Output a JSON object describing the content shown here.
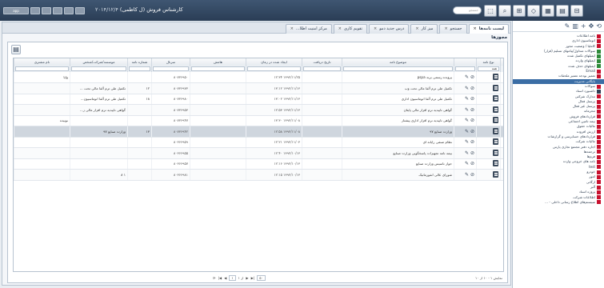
{
  "topbar": {
    "title": "کارشناس فروش (ل کاظمی)",
    "date": "۲۰۱۴/۱۲/۴",
    "search_placeholder": "جستجو",
    "window_buttons": [
      "",
      "",
      "",
      "",
      ""
    ],
    "right_buttons": [
      "⬚",
      "🔍",
      "⊞",
      "◇",
      "▦",
      "⊟"
    ]
  },
  "tabs": [
    {
      "label": "لیست نامه‌ها",
      "active": true
    },
    {
      "label": "جستجو",
      "active": false
    },
    {
      "label": "میز کار",
      "active": false
    },
    {
      "label": "درس جدید دمو",
      "active": false
    },
    {
      "label": "تقویم کاری",
      "active": false
    },
    {
      "label": "مرکز امنیت اطلا...",
      "active": false
    }
  ],
  "panel_title": "مجوزها",
  "columns": [
    "",
    "نوع نامه",
    "",
    "موضوع نامه",
    "تاریخ دریافت",
    "ایجاد شده در زمان",
    "هامش",
    "سرنال",
    "شماره نامه",
    "موسسه/شرکت/شخص",
    "نام مشتری"
  ],
  "filters": [
    "",
    "همه",
    "",
    "",
    "",
    "",
    "",
    "",
    "",
    "",
    ""
  ],
  "rows": [
    {
      "num": "۱",
      "subject": "پرونده رسمی برند pspa",
      "date": "۱۳۹۲/۱۱/۲۵ ۱۲:۳۴",
      "serial": "۸۰۷۳۶۹۵۰",
      "letter_no": "",
      "org": "",
      "customer": "وایا"
    },
    {
      "num": "۲",
      "subject": "تکمیل طی ترم آلفا مالی تحت وب",
      "date": "۱۳۹۲/۱۱/۱۳ ۱۳:۱۲",
      "serial": "۸۰۷۳۶۹۷۳",
      "letter_no": "۱۲",
      "org": "تکمیل طی ترم آلفا مالی تحت ...",
      "customer": ""
    },
    {
      "num": "۳",
      "subject": "تکمیل طی ترم آلفا اتوماسیون اداری",
      "date": "۱۳۹۲/۱۱/۱۳ ۱۳:۰۲",
      "serial": "۸۰۷۳۶۹۸۰",
      "letter_no": "۱۸",
      "org": "تکمیل طی ترم آلفا اتوماسیون...",
      "customer": ""
    },
    {
      "num": "۴",
      "subject": "گواهی تاییدیه نرم افزار مالی پایتان",
      "date": "۱۳۹۲/۱۱/۱۳ ۱۲:۵۳",
      "serial": "۸۰۷۳۶۹۵۳",
      "letter_no": "",
      "org": "گواهی تاییدیه نرم افزار مالی ز...",
      "customer": ""
    },
    {
      "num": "۵",
      "subject": "گواهی تاییدیه نرم افزار اداری پیشتاز",
      "date": "۱۳۹۲/۱۱/۰۸ ۱۳:۳۰",
      "serial": "۸۰۷۳۶۹۴۷",
      "letter_no": "",
      "org": "",
      "customer": "نونیده"
    },
    {
      "num": "۶",
      "subject": "وزارت صنایع ۹۷",
      "date": "۱۳۹۲/۱۱/۰۸ ۱۲:۵۸",
      "serial": "۸۰۷۳۶۹۴۲",
      "letter_no": "۱۳",
      "org": "وزارت صنایع ۹۷",
      "customer": ""
    },
    {
      "num": "۷",
      "subject": "نظام صنفی رایانه ای",
      "date": "۱۳۹۲/۱۱/۰۳ ۱۲:۲۱",
      "serial": "۸۰۳۶۶۹۵۹",
      "letter_no": "",
      "org": "",
      "customer": ""
    },
    {
      "num": "۸",
      "subject": "بیمه نامه تجهیزات پاسخگویی وزارت صنایع",
      "date": "۱۳۹۲/۱۰/۱۳ ۱۲:۴۰",
      "serial": "۸۰۳۶۶۹۵۵",
      "letter_no": "",
      "org": "",
      "customer": ""
    },
    {
      "num": "۹",
      "subject": "جواز تاسیس وزارت صنایع",
      "date": "۱۳۹۲/۱۰/۱۳ ۱۲:۱۶",
      "serial": "۸۰۳۶۶۹۵۷",
      "letter_no": "",
      "org": "",
      "customer": ""
    },
    {
      "num": "۱۰",
      "subject": "شوراى عالی انفورماتیک",
      "date": "۱۳۹۲/۱۰/۱۳ ۱۲:۱۵",
      "serial": "۸۰۳۶۶۹۸۱",
      "letter_no": "",
      "org": "۱ ۸",
      "customer": ""
    }
  ],
  "pager": {
    "info": "نمایش ۱ - ۱۰ از ۱۰",
    "page": "۱",
    "of": "از ۱",
    "size": "۵۰"
  },
  "sidebar": {
    "tools": [
      "⟲",
      "✥",
      "+",
      "▥",
      "✎"
    ],
    "items": [
      {
        "label": "نامه اطلاعات",
        "color": "#c8102e"
      },
      {
        "label": "اتوماسیون اداری",
        "color": "#c8102e"
      },
      {
        "label": "کاملیا / وضعیت مجوز",
        "color": "#c8102e"
      },
      {
        "label": "سوالات متداول/پیامهاى تسلیم (قرار)",
        "color": "#2e8b3a"
      },
      {
        "label": "ایمیلهای تکمیل شده",
        "color": "#2e8b3a"
      },
      {
        "label": "ایمیلهای وارده",
        "color": "#2e8b3a"
      },
      {
        "label": "ایمیلهای حذف شده",
        "color": "#2e8b3a"
      },
      {
        "label": "Email",
        "color": "#c8102e"
      },
      {
        "label": "تعمیر بودجه تعمیر ملحقات",
        "color": "#c8102e"
      },
      {
        "label": "بایگانی مدیریت",
        "color": "#3b6ea5",
        "selected": true
      },
      {
        "label": "سوالات",
        "color": "#c8102e"
      },
      {
        "label": "داشبورد اسناد",
        "color": "#2f3f55"
      },
      {
        "label": "مدارک شرکتی",
        "color": "#c8102e"
      },
      {
        "label": "پرسنل فعال",
        "color": "#c8102e"
      },
      {
        "label": "پرسنل غیر فعال",
        "color": "#c8102e"
      },
      {
        "label": "محرمانه",
        "color": "#c8102e"
      },
      {
        "label": "قراردادهای فروش",
        "color": "#c8102e"
      },
      {
        "label": "بیمه تامین اجتماعی",
        "color": "#c8102e"
      },
      {
        "label": "مالیات حقوق",
        "color": "#c8102e"
      },
      {
        "label": "ارزش افزوده",
        "color": "#c8102e"
      },
      {
        "label": "قراردادهای حسابرسی و گزارشات",
        "color": "#c8102e"
      },
      {
        "label": "مالیات شرکت",
        "color": "#c8102e"
      },
      {
        "label": "اجاره دفتر مجتمع تجاری پارس",
        "color": "#c8102e"
      },
      {
        "label": "ترجمه‌ها",
        "color": "#c8102e"
      },
      {
        "label": "فرم‌ها",
        "color": "#c8102e"
      },
      {
        "label": "نامه های خروجی وارده",
        "color": "#c8102e"
      },
      {
        "label": "test",
        "color": "#c8102e"
      },
      {
        "label": "خودرو",
        "color": "#c8102e"
      },
      {
        "label": "امور",
        "color": "#c8102e"
      },
      {
        "label": "ارگانی",
        "color": "#c8102e"
      },
      {
        "label": "آلبر",
        "color": "#c8102e"
      },
      {
        "label": "پروژه اسناد",
        "color": "#c8102e"
      },
      {
        "label": "اطلاعات شرکت",
        "color": "#c8102e"
      },
      {
        "label": "سیستم‌های اطلاع رسانی داخلی - ...",
        "color": "#c8102e"
      }
    ]
  }
}
